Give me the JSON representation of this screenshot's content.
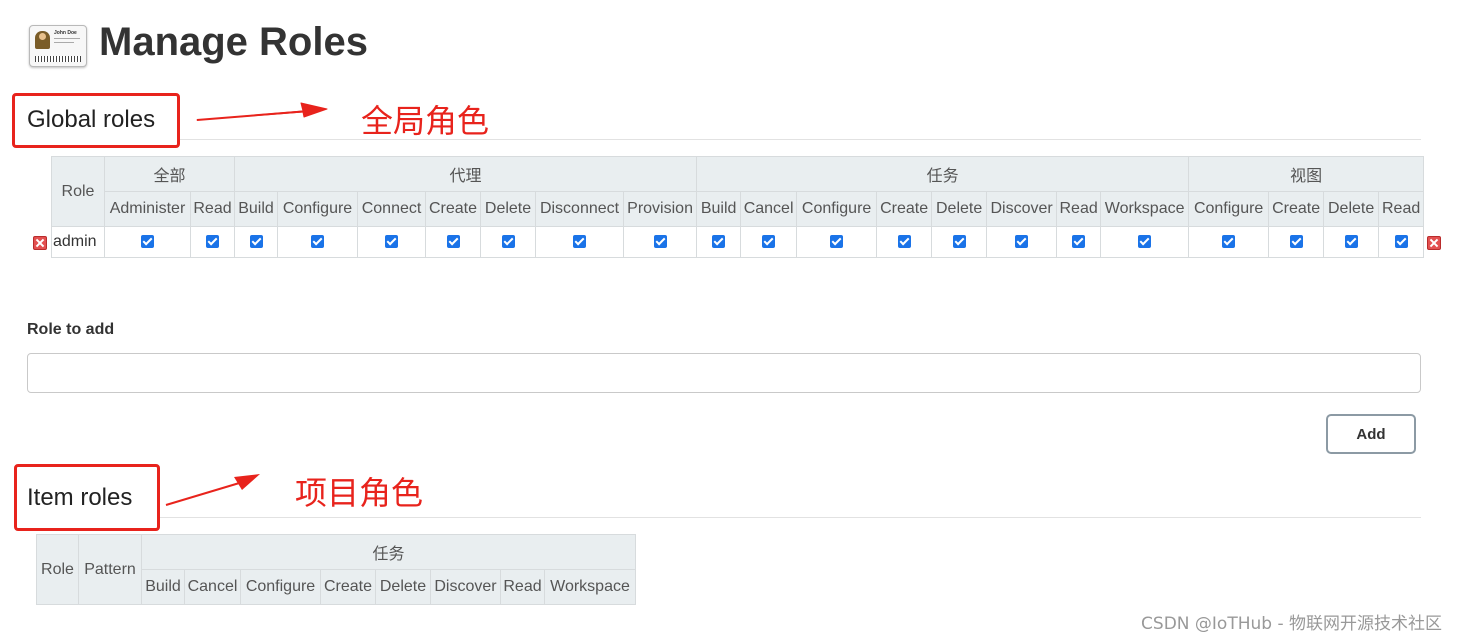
{
  "page": {
    "title": "Manage Roles",
    "icon": "id-card-icon",
    "icon_card_name": "John Doe"
  },
  "global_roles": {
    "title": "Global roles",
    "annotation": "全局角色",
    "role_header": "Role",
    "groups": [
      {
        "label": "全部",
        "permissions": [
          "Administer",
          "Read"
        ]
      },
      {
        "label": "代理",
        "permissions": [
          "Build",
          "Configure",
          "Connect",
          "Create",
          "Delete",
          "Disconnect",
          "Provision"
        ]
      },
      {
        "label": "任务",
        "permissions": [
          "Build",
          "Cancel",
          "Configure",
          "Create",
          "Delete",
          "Discover",
          "Read",
          "Workspace"
        ]
      },
      {
        "label": "视图",
        "permissions": [
          "Configure",
          "Create",
          "Delete",
          "Read"
        ]
      }
    ],
    "rows": [
      {
        "name": "admin",
        "checked": [
          true,
          true,
          true,
          true,
          true,
          true,
          true,
          true,
          true,
          true,
          true,
          true,
          true,
          true,
          true,
          true,
          true,
          true,
          true,
          true,
          true
        ]
      }
    ]
  },
  "add_role": {
    "label": "Role to add",
    "value": "",
    "button_label": "Add"
  },
  "item_roles": {
    "title": "Item roles",
    "annotation": "项目角色",
    "role_header": "Role",
    "pattern_header": "Pattern",
    "groups": [
      {
        "label": "任务",
        "permissions": [
          "Build",
          "Cancel",
          "Configure",
          "Create",
          "Delete",
          "Discover",
          "Read",
          "Workspace"
        ]
      }
    ]
  },
  "watermark": "CSDN @IoTHub - 物联网开源技术社区",
  "colors": {
    "annotation_red": "#e8231c",
    "header_bg": "#e9eef0",
    "checkbox_blue": "#1a73e8",
    "delete_red": "#e35050"
  }
}
